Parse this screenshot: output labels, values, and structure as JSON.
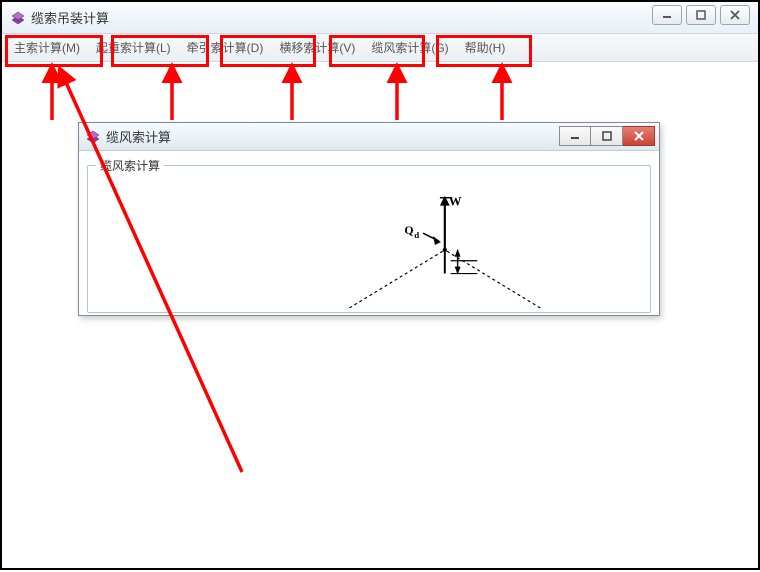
{
  "outer": {
    "title": "缆索吊装计算"
  },
  "menu": {
    "items": [
      {
        "label": "主索计算(M)"
      },
      {
        "label": "起重索计算(L)"
      },
      {
        "label": "牵引索计算(D)"
      },
      {
        "label": "横移索计算(V)"
      },
      {
        "label": "缆风索计算(G)"
      },
      {
        "label": "帮助(H)"
      }
    ]
  },
  "child": {
    "title": "缆风索计算",
    "group_label": "缆风索计算"
  },
  "colors": {
    "highlight": "#ff0000",
    "close": "#c94434"
  }
}
